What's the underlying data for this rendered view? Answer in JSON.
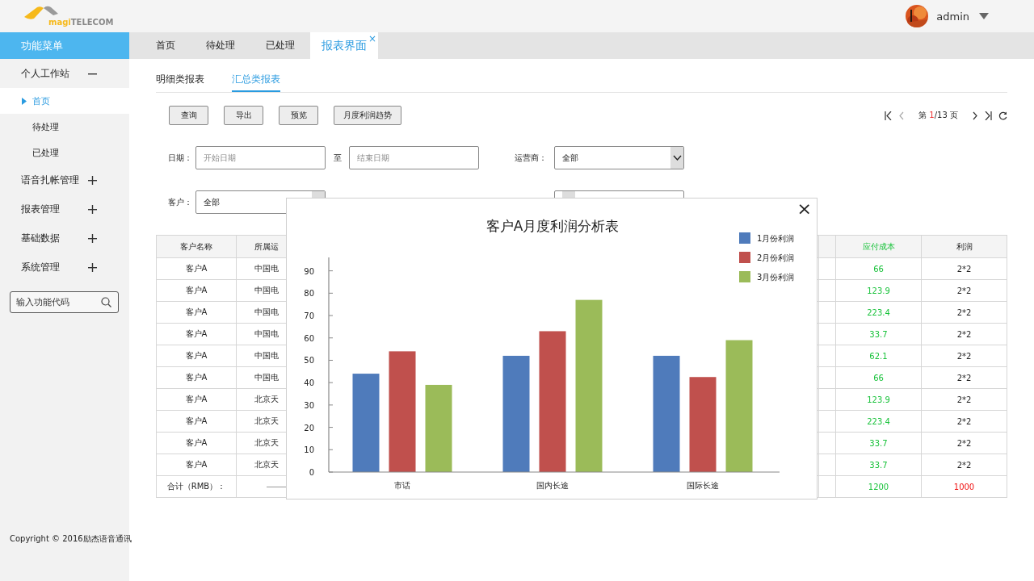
{
  "header": {
    "logo": {
      "prefix": "magi",
      "suffix": "TELECOM"
    },
    "user": "admin"
  },
  "sidebar": {
    "title": "功能菜单",
    "items": [
      {
        "label": "个人工作站",
        "expanded": true,
        "children": [
          {
            "label": "首页",
            "selected": true
          },
          {
            "label": "待处理",
            "selected": false
          },
          {
            "label": "已处理",
            "selected": false
          }
        ]
      },
      {
        "label": "语音扎帐管理",
        "expanded": false
      },
      {
        "label": "报表管理",
        "expanded": false
      },
      {
        "label": "基础数据",
        "expanded": false
      },
      {
        "label": "系统管理",
        "expanded": false
      }
    ],
    "search": {
      "placeholder": "输入功能代码"
    },
    "copyright": "Copyright © 2016励杰语音通讯"
  },
  "tabs": [
    {
      "label": "首页",
      "selected": false
    },
    {
      "label": "待处理",
      "selected": false
    },
    {
      "label": "已处理",
      "selected": false
    },
    {
      "label": "报表界面",
      "selected": true,
      "close": "×"
    }
  ],
  "subtabs": [
    {
      "label": "明细类报表",
      "selected": false
    },
    {
      "label": "汇总类报表",
      "selected": true
    }
  ],
  "buttons": [
    "查询",
    "导出",
    "预览",
    "月度利润趋势"
  ],
  "pagination": {
    "prefix": "第",
    "current": "1",
    "suffix": "/13 页"
  },
  "filters": {
    "date_label": "日期：",
    "start_placeholder": "开始日期",
    "to": "至",
    "end_placeholder": "结束日期",
    "carrier_label": "运营商：",
    "carrier_value": "全部",
    "customer_label": "客户：",
    "customer_value": "全部"
  },
  "table": {
    "columns": [
      "客户名称",
      "所属运",
      "应付成本",
      "利润"
    ],
    "rows": [
      {
        "customer": "客户A",
        "carrier": "中国电",
        "cost": "66",
        "profit": "2*2"
      },
      {
        "customer": "客户A",
        "carrier": "中国电",
        "cost": "123.9",
        "profit": "2*2"
      },
      {
        "customer": "客户A",
        "carrier": "中国电",
        "cost": "223.4",
        "profit": "2*2"
      },
      {
        "customer": "客户A",
        "carrier": "中国电",
        "cost": "33.7",
        "profit": "2*2"
      },
      {
        "customer": "客户A",
        "carrier": "中国电",
        "cost": "62.1",
        "profit": "2*2"
      },
      {
        "customer": "客户A",
        "carrier": "中国电",
        "cost": "66",
        "profit": "2*2"
      },
      {
        "customer": "客户A",
        "carrier": "北京天",
        "cost": "123.9",
        "profit": "2*2"
      },
      {
        "customer": "客户A",
        "carrier": "北京天",
        "cost": "223.4",
        "profit": "2*2"
      },
      {
        "customer": "客户A",
        "carrier": "北京天",
        "cost": "33.7",
        "profit": "2*2"
      },
      {
        "customer": "客户A",
        "carrier": "北京天",
        "cost": "33.7",
        "profit": "2*2"
      }
    ],
    "total": {
      "label": "合计（RMB）：",
      "cost": "1200",
      "profit": "1000"
    }
  },
  "modal": {
    "close": "×",
    "chart_data": {
      "type": "bar",
      "title": "客户A月度利润分析表",
      "categories": [
        "市话",
        "国内长途",
        "国际长途"
      ],
      "series": [
        {
          "name": "1月份利润",
          "color": "#4f7bbb",
          "values": [
            44,
            52,
            52
          ]
        },
        {
          "name": "2月份利润",
          "color": "#c0504d",
          "values": [
            54,
            63,
            42.5
          ]
        },
        {
          "name": "3月份利润",
          "color": "#9bbb59",
          "values": [
            39,
            77,
            59
          ]
        }
      ],
      "legend": "top-right",
      "ylim": [
        0,
        96
      ],
      "yticks": [
        0,
        10,
        20,
        30,
        40,
        50,
        60,
        70,
        80,
        90
      ]
    }
  }
}
